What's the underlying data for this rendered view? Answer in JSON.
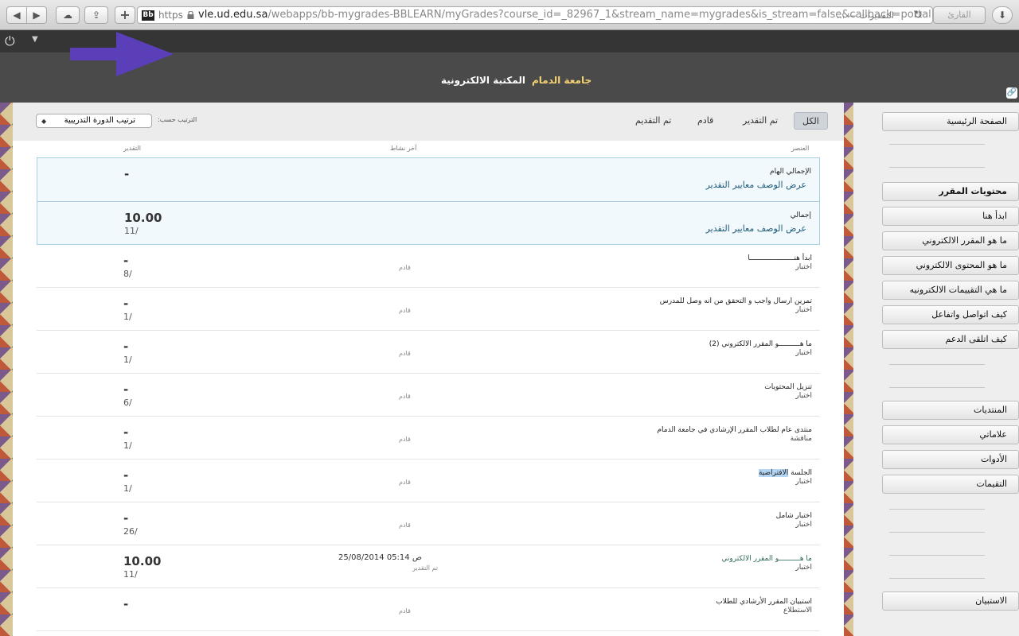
{
  "browser": {
    "favicon": "Bb",
    "protocol": "https",
    "url_host": "vle.ud.edu.sa",
    "url_path": "/webapps/bb-mygrades-BBLEARN/myGrades?course_id=_82967_1&stream_name=mygrades&is_stream=false&callback=portal",
    "page_title": "التقديرات — ...",
    "reader_label": "القارئ",
    "icons": [
      "back-icon",
      "forward-icon",
      "cloud-icon",
      "share-icon",
      "plus-icon",
      "lock-icon",
      "reload-icon",
      "download-icon"
    ]
  },
  "header": {
    "tabs": [
      {
        "label": "جامعة الدمام",
        "active": true
      },
      {
        "label": "المكتبة الالكترونية",
        "active": false
      }
    ],
    "accent_color": "#f5d372"
  },
  "filters": {
    "all": "الكل",
    "graded": "تم التقدير",
    "upcoming": "قادم",
    "submitted": "تم التقديم",
    "sort_label": "الترتيب حسب:",
    "sort_value": "ترتيب الدورة التدريبية"
  },
  "columns": {
    "item": "العنصر",
    "last_activity": "آخر نشاط",
    "grade": "التقدير"
  },
  "summary_rows": [
    {
      "title": "الإجمالي الهام",
      "links": "عرض الوصف  معايير التقدير",
      "grade": "-",
      "max": ""
    },
    {
      "title": "إجمالي",
      "links": "عرض الوصف  معايير التقدير",
      "grade": "10.00",
      "max": "11/"
    }
  ],
  "rows": [
    {
      "title": "ابدأ هنـــــــــــــــــــــا",
      "type": "اختبار",
      "status": "قادم",
      "date": "",
      "grade": "-",
      "max": "8/"
    },
    {
      "title": "تمرين ارسال واجب و التحقق من انه وصل للمدرس",
      "type": "اختبار",
      "status": "قادم",
      "date": "",
      "grade": "-",
      "max": "1/"
    },
    {
      "title": "ما هــــــــــو المقرر الالكتروني (2)",
      "type": "اختبار",
      "status": "قادم",
      "date": "",
      "grade": "-",
      "max": "1/"
    },
    {
      "title": "تنزيل المحتويات",
      "type": "اختبار",
      "status": "قادم",
      "date": "",
      "grade": "-",
      "max": "6/"
    },
    {
      "title": "منتدى عام لطلاب المقرر الإرشادي في جامعة الدمام",
      "type": "مناقشة",
      "status": "قادم",
      "date": "",
      "grade": "-",
      "max": "1/"
    },
    {
      "title_plain": "الجلسة ",
      "title_highlight": "الافتراضية",
      "type": "اختبار",
      "status": "قادم",
      "date": "",
      "grade": "-",
      "max": "1/"
    },
    {
      "title": "اختبار شامل",
      "type": "اختبار",
      "status": "قادم",
      "date": "",
      "grade": "-",
      "max": "26/"
    },
    {
      "title": "ما هــــــــــو المقرر الالكتروني",
      "type": "اختبار",
      "status": "تم التقدير",
      "date": "25/08/2014 05:14 ص",
      "grade": "10.00",
      "max": "11/"
    },
    {
      "title": "استبيان المقرر الأرشادي للطلاب",
      "type": "الاستطلاع",
      "status": "قادم",
      "date": "",
      "grade": "-",
      "max": ""
    }
  ],
  "sidebar": {
    "items": [
      {
        "label": "الصفحة الرئيسية",
        "header": false
      },
      {
        "label": "محتويات المقرر",
        "header": true
      },
      {
        "label": "ابدأ هنا",
        "header": false
      },
      {
        "label": "ما هو المقرر الالكتروني",
        "header": false
      },
      {
        "label": "ما هو المحتوى الالكتروني",
        "header": false
      },
      {
        "label": "ما هي التقييمات الالكترونيه",
        "header": false
      },
      {
        "label": "كيف اتواصل واتفاعل",
        "header": false
      },
      {
        "label": "كيف اتلقى الدعم",
        "header": false
      },
      {
        "label": "المنتديات",
        "header": false
      },
      {
        "label": "علاماتي",
        "header": false
      },
      {
        "label": "الأدوات",
        "header": false
      },
      {
        "label": "التقيمات",
        "header": false
      },
      {
        "label": "الاستبيان",
        "header": false
      }
    ]
  }
}
